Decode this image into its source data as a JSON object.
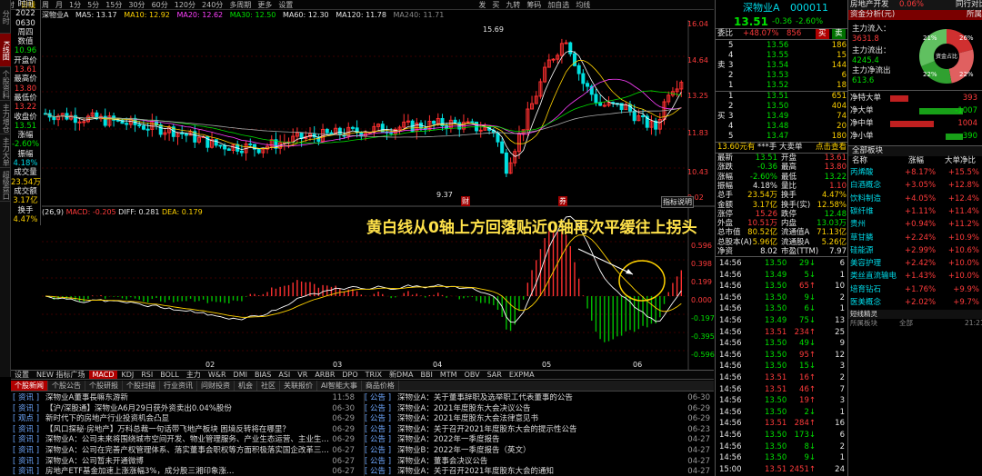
{
  "top_bar": {
    "left_items": [
      "分时",
      "日线",
      "周",
      "月",
      "1分",
      "5分",
      "15分",
      "30分",
      "60分",
      "120分",
      "240分",
      "多周期",
      "更多",
      "设置"
    ],
    "selected": "日线",
    "right_items": [
      "发",
      "买",
      "九转",
      "筹码",
      "加自选",
      "均线",
      "",
      "",
      ""
    ]
  },
  "ma_header": {
    "name": "深物业A",
    "ma5": "MA5: 13.17",
    "ma10": "MA10: 12.92",
    "ma20": "MA20: 12.62",
    "ma30": "MA30: 12.50",
    "ma60": "MA60: 12.30",
    "ma120": "MA120: 11.78",
    "ma240": "MA240: 11.71"
  },
  "left_tabs": [
    "分时",
    "K线图",
    "个股资料",
    "主力增仓",
    "主力大单",
    "超级盘口"
  ],
  "info_panel": [
    {
      "t": "时间",
      "c": "wht"
    },
    {
      "t": "2022",
      "c": "wht"
    },
    {
      "t": "0630",
      "c": "wht"
    },
    {
      "t": "周四",
      "c": "wht"
    },
    {
      "t": "数值",
      "c": "wht"
    },
    {
      "t": "10.96",
      "c": "grn"
    },
    {
      "t": "开盘价",
      "c": "wht"
    },
    {
      "t": "13.61",
      "c": "red"
    },
    {
      "t": "最高价",
      "c": "wht"
    },
    {
      "t": "13.80",
      "c": "red"
    },
    {
      "t": "最低价",
      "c": "wht"
    },
    {
      "t": "13.22",
      "c": "red"
    },
    {
      "t": "收盘价",
      "c": "wht"
    },
    {
      "t": "13.51",
      "c": "grn"
    },
    {
      "t": "涨幅",
      "c": "wht"
    },
    {
      "t": "-2.60%",
      "c": "grn"
    },
    {
      "t": "振幅",
      "c": "wht"
    },
    {
      "t": "4.18%",
      "c": "cya"
    },
    {
      "t": "成交量",
      "c": "wht"
    },
    {
      "t": "23.54万",
      "c": "yel"
    },
    {
      "t": "成交额",
      "c": "wht"
    },
    {
      "t": "3.17亿",
      "c": "yel"
    },
    {
      "t": "换手",
      "c": "wht"
    },
    {
      "t": "4.47%",
      "c": "yel"
    }
  ],
  "price_axis": [
    "16.04",
    "14.64",
    "13.25",
    "11.83",
    "10.43",
    "9.02"
  ],
  "macd_axis": [
    "0.596",
    "0.398",
    "0.199",
    "0.000",
    "-0.197",
    "-0.395",
    "-0.596"
  ],
  "annotations": {
    "high": "15.69",
    "low": "9.37",
    "mark1": "财",
    "mark2": "券",
    "indicator_btn": "指标说明"
  },
  "macd_header": {
    "params": "(26,9)",
    "macd": "MACD: -0.205",
    "diff": "DIFF: 0.281",
    "dea": "DEA: 0.179"
  },
  "overlay_text": "黄白线从0轴上方回落贴近0轴再次平缓往上拐头",
  "months": [
    "",
    "02",
    "03",
    "04",
    "05",
    "06"
  ],
  "indicator_tabs": [
    "设置",
    "NEW 指标广场",
    "MACD",
    "KDJ",
    "RSI",
    "BOLL",
    "主力",
    "W&R",
    "DMI",
    "BIAS",
    "ASI",
    "VR",
    "ARBR",
    "DPO",
    "TRIX",
    "新DMA",
    "BBI",
    "MTM",
    "OBV",
    "SAR",
    "EXPMA"
  ],
  "indicator_selected": "MACD",
  "news_tabs": [
    "个股新闻",
    "个股公告",
    "个股研报",
    "个股扫描",
    "行业资讯",
    "问财投资",
    "机会",
    "社区",
    "关联报价",
    "AI智能大事",
    "商品价格"
  ],
  "news_selected": "个股新闻",
  "news_left": [
    {
      "tag": "资讯",
      "title": "深物业A董事長嘛东游新",
      "date": "11:58"
    },
    {
      "tag": "资讯",
      "title": "【沪/深股通】深物业A6月29日获外资卖出0.04%股份",
      "date": "06-30"
    },
    {
      "tag": "观点",
      "title": "新时代下的房地产行业投资机会凸显",
      "date": "06-29"
    },
    {
      "tag": "资讯",
      "title": "【风口探秘·房地产】万科总裁一句话带飞地产板块 困境反转将在哪里？",
      "date": "06-29"
    },
    {
      "tag": "资讯",
      "title": "深物业A：公司未来将围绕城市空间开发、物业管理服务、产业生态运营、主业生…",
      "date": "06-29"
    },
    {
      "tag": "资讯",
      "title": "深物业A：公司在完善产权管理体系、落实董事会职权等方面积极落实国企改革三…",
      "date": "06-27"
    },
    {
      "tag": "资讯",
      "title": "深物业A：公司暂未开通微博",
      "date": "06-27"
    },
    {
      "tag": "资讯",
      "title": "房地产ETF基金加速上涨涨幅3%，成分股三湘印象涨…",
      "date": "06-27"
    }
  ],
  "news_right": [
    {
      "tag": "公告",
      "title": "深物业A：关于董事辞职及选举职工代表董事的公告",
      "date": "06-30"
    },
    {
      "tag": "公告",
      "title": "深物业A：2021年度股东大会决议公告",
      "date": "06-29"
    },
    {
      "tag": "公告",
      "title": "深物业A：2021年度股东大会法律意见书",
      "date": "06-29"
    },
    {
      "tag": "公告",
      "title": "深物业A：关于召开2021年度股东大会的提示性公告",
      "date": "06-23"
    },
    {
      "tag": "公告",
      "title": "深物业A：2022年一季度报告",
      "date": "04-27"
    },
    {
      "tag": "公告",
      "title": "深物业B：2022年一季度报告（英文）",
      "date": "04-27"
    },
    {
      "tag": "公告",
      "title": "深物业A：董事会决议公告",
      "date": "04-27"
    },
    {
      "tag": "公告",
      "title": "深物业A：关于召开2021年度股东大会的通知",
      "date": "04-27"
    }
  ],
  "quote": {
    "name": "深物业A",
    "code": "000011",
    "price": "13.51",
    "chg": "-0.36",
    "pct": "-2.60%",
    "weibi_label": "委比",
    "weibi": "+48.07%",
    "weicha": "856",
    "buy_btn": "买",
    "sell_btn": "卖",
    "sell_orders": [
      {
        "l": "5",
        "p": "13.56",
        "v": "186"
      },
      {
        "l": "4",
        "p": "13.55",
        "v": "15"
      },
      {
        "l": "3",
        "p": "13.54",
        "v": "144"
      },
      {
        "l": "2",
        "p": "13.53",
        "v": "6"
      },
      {
        "l": "1",
        "p": "13.52",
        "v": "18"
      }
    ],
    "buy_orders": [
      {
        "l": "1",
        "p": "13.51",
        "v": "651"
      },
      {
        "l": "2",
        "p": "13.50",
        "v": "404"
      },
      {
        "l": "3",
        "p": "13.49",
        "v": "74"
      },
      {
        "l": "4",
        "p": "13.48",
        "v": "20"
      },
      {
        "l": "5",
        "p": "13.47",
        "v": "180"
      }
    ],
    "big_line": {
      "a": "13.60元有",
      "b": "***手",
      "c": "大卖单",
      "d": "点击查看"
    },
    "stats": [
      {
        "k1": "最新",
        "v1": "13.51",
        "c1": "grn",
        "k2": "开盘",
        "v2": "13.61",
        "c2": "red"
      },
      {
        "k1": "涨跌",
        "v1": "-0.36",
        "c1": "grn",
        "k2": "最高",
        "v2": "13.80",
        "c2": "red"
      },
      {
        "k1": "涨幅",
        "v1": "-2.60%",
        "c1": "grn",
        "k2": "最低",
        "v2": "13.22",
        "c2": "grn"
      },
      {
        "k1": "振幅",
        "v1": "4.18%",
        "c1": "wht",
        "k2": "量比",
        "v2": "1.10",
        "c2": "red"
      },
      {
        "k1": "总手",
        "v1": "23.54万",
        "c1": "yel",
        "k2": "换手",
        "v2": "4.47%",
        "c2": "yel"
      },
      {
        "k1": "金额",
        "v1": "3.17亿",
        "c1": "yel",
        "k2": "换手(实)",
        "v2": "12.58%",
        "c2": "yel"
      },
      {
        "k1": "涨停",
        "v1": "15.26",
        "c1": "red",
        "k2": "跌停",
        "v2": "12.48",
        "c2": "grn"
      },
      {
        "k1": "外盘",
        "v1": "10.51万",
        "c1": "red",
        "k2": "内盘",
        "v2": "13.03万",
        "c2": "grn"
      },
      {
        "k1": "总市值",
        "v1": "80.52亿",
        "c1": "yel",
        "k2": "流通值A",
        "v2": "71.13亿",
        "c2": "yel"
      },
      {
        "k1": "总股本(A)",
        "v1": "5.96亿",
        "c1": "yel",
        "k2": "流通股A",
        "v2": "5.26亿",
        "c2": "yel"
      },
      {
        "k1": "净资",
        "v1": "8.02",
        "c1": "wht",
        "k2": "市盈(TTM)",
        "v2": "7.97",
        "c2": "wht"
      }
    ],
    "ticks": [
      {
        "t": "14:56",
        "p": "13.50",
        "v": "29",
        "d": "down",
        "n": "6"
      },
      {
        "t": "14:56",
        "p": "13.49",
        "v": "5",
        "d": "down",
        "n": "1"
      },
      {
        "t": "14:56",
        "p": "13.50",
        "v": "65",
        "d": "up",
        "n": "10"
      },
      {
        "t": "14:56",
        "p": "13.50",
        "v": "9",
        "d": "down",
        "n": "2"
      },
      {
        "t": "14:56",
        "p": "13.50",
        "v": "6",
        "d": "down",
        "n": "1"
      },
      {
        "t": "14:56",
        "p": "13.49",
        "v": "75",
        "d": "down",
        "n": "13"
      },
      {
        "t": "14:56",
        "p": "13.51",
        "v": "234",
        "d": "up",
        "n": "25"
      },
      {
        "t": "14:56",
        "p": "13.50",
        "v": "49",
        "d": "down",
        "n": "9"
      },
      {
        "t": "14:56",
        "p": "13.50",
        "v": "95",
        "d": "up",
        "n": "12"
      },
      {
        "t": "14:56",
        "p": "13.50",
        "v": "15",
        "d": "down",
        "n": "3"
      },
      {
        "t": "14:56",
        "p": "13.51",
        "v": "16",
        "d": "up",
        "n": "2"
      },
      {
        "t": "14:56",
        "p": "13.51",
        "v": "46",
        "d": "up",
        "n": "7"
      },
      {
        "t": "14:56",
        "p": "13.50",
        "v": "19",
        "d": "up",
        "n": "3"
      },
      {
        "t": "14:56",
        "p": "13.50",
        "v": "2",
        "d": "down",
        "n": "1"
      },
      {
        "t": "14:56",
        "p": "13.51",
        "v": "284",
        "d": "up",
        "n": "16"
      },
      {
        "t": "14:56",
        "p": "13.50",
        "v": "173",
        "d": "down",
        "n": "6"
      },
      {
        "t": "14:56",
        "p": "13.50",
        "v": "8",
        "d": "down",
        "n": "2"
      },
      {
        "t": "14:56",
        "p": "13.50",
        "v": "9",
        "d": "down",
        "n": "1"
      },
      {
        "t": "15:00",
        "p": "13.51",
        "v": "2451",
        "d": "up",
        "n": "24"
      }
    ]
  },
  "right_panel": {
    "sector": "房地产开发",
    "sector_pct": "0.06%",
    "peer": "同行对比",
    "fund_title": "资金分析(元)",
    "fund_tab": "所属",
    "main_in_label": "主力流入：",
    "main_in": "3631.8",
    "main_out_label": "主力流出：",
    "main_out": "4245.4",
    "main_net_label": "主力净流出",
    "main_net": "613.6",
    "pie_labels": [
      "21%",
      "26%",
      "22%",
      "22%"
    ],
    "pie_center": "资金占比",
    "bars": [
      {
        "k": "净特大单",
        "v": "393",
        "c": "red",
        "f": 0.25
      },
      {
        "k": "净大单",
        "v": "-1007",
        "c": "grn",
        "f": 0.6
      },
      {
        "k": "净中单",
        "v": "1004",
        "c": "red",
        "f": 0.6
      },
      {
        "k": "净小单",
        "v": "-390",
        "c": "grn",
        "f": 0.24
      }
    ],
    "list_headers": [
      "名称",
      "涨幅",
      "大单净比"
    ],
    "list_title": "全部板块",
    "concepts": [
      {
        "n": "丙烯酸",
        "a": "+8.17%",
        "b": "+15.5%"
      },
      {
        "n": "白酒概念",
        "a": "+3.05%",
        "b": "+12.8%"
      },
      {
        "n": "饮料制造",
        "a": "+4.05%",
        "b": "+12.4%"
      },
      {
        "n": "碳纤维",
        "a": "+1.11%",
        "b": "+11.4%"
      },
      {
        "n": "贵州",
        "a": "+0.94%",
        "b": "+11.2%"
      },
      {
        "n": "草甘膦",
        "a": "+2.24%",
        "b": "+10.9%"
      },
      {
        "n": "硅能源",
        "a": "+2.99%",
        "b": "+10.6%"
      },
      {
        "n": "美容护理",
        "a": "+2.42%",
        "b": "+10.0%"
      },
      {
        "n": "类丝直流输电",
        "a": "+1.43%",
        "b": "+10.0%"
      },
      {
        "n": "培育钻石",
        "a": "+1.76%",
        "b": "+9.9%"
      },
      {
        "n": "医美概念",
        "a": "+2.02%",
        "b": "+9.7%"
      }
    ],
    "bottom_labels": [
      "短线精灵",
      "所属板块",
      "全部",
      "21:21"
    ]
  }
}
